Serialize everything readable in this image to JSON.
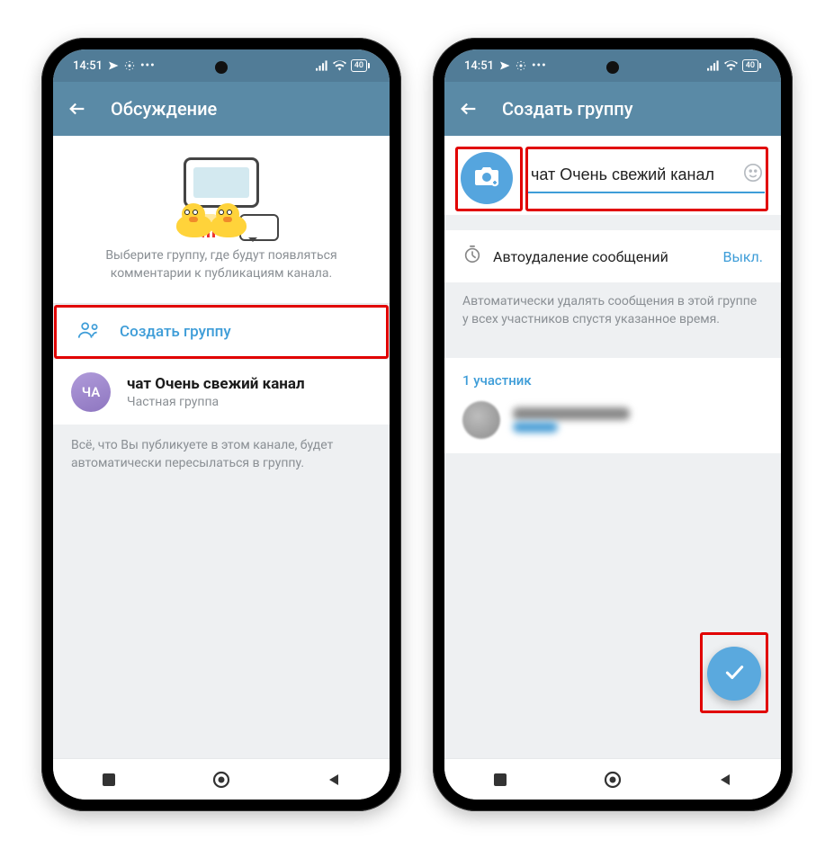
{
  "status": {
    "time": "14:51",
    "battery": "40"
  },
  "phone1": {
    "appbar_title": "Обсуждение",
    "hero_hint": "Выберите группу, где будут появляться комментарии к публикациям канала.",
    "create_label": "Создать группу",
    "chat_avatar_initials": "ЧА",
    "chat_title": "чат Очень свежий канал",
    "chat_sub": "Частная группа",
    "footnote": "Всё, что Вы публикуете в этом канале, будет автоматически пересылаться в группу."
  },
  "phone2": {
    "appbar_title": "Создать группу",
    "name_value": "чат Очень свежий канал",
    "auto_delete_label": "Автоудаление сообщений",
    "auto_delete_value": "Выкл.",
    "auto_delete_hint": "Автоматически удалять сообщения в этой группе у всех участников спустя указанное время.",
    "members_header": "1 участник"
  }
}
